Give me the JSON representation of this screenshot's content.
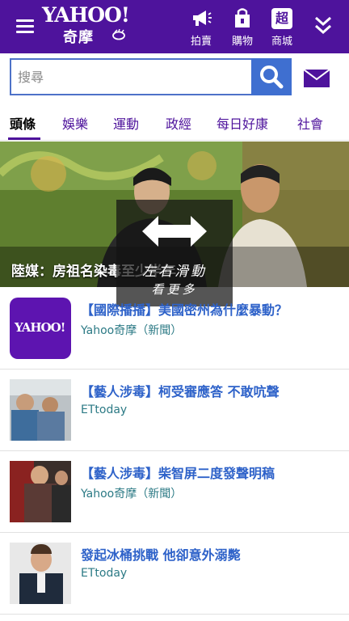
{
  "header": {
    "logo_en": "YAHOO!",
    "logo_zh": "奇摩",
    "items": [
      {
        "label": "拍賣",
        "icon": "megaphone-icon"
      },
      {
        "label": "購物",
        "icon": "shopping-bag-icon"
      },
      {
        "label": "商城",
        "icon": "mall-chao-icon",
        "glyph": "超"
      }
    ],
    "more_icon": "double-chevron-down-icon",
    "brand_color": "#4e139c"
  },
  "search": {
    "placeholder": "搜尋",
    "button_icon": "search-icon",
    "mail_icon": "mail-icon"
  },
  "tabs": [
    {
      "label": "頭條",
      "active": true
    },
    {
      "label": "娛樂",
      "active": false
    },
    {
      "label": "運動",
      "active": false
    },
    {
      "label": "政經",
      "active": false
    },
    {
      "label": "每日好康",
      "active": false
    },
    {
      "label": "社會",
      "active": false
    }
  ],
  "hero": {
    "caption": "陸媒：房祖名染毒至少半年",
    "swipe_hint": {
      "line1": "左右滑動",
      "line2": "看更多",
      "icon": "swipe-arrows-icon"
    }
  },
  "news": [
    {
      "title": "【國際播播】美國密州為什麼暴動？",
      "source": "Yahoo奇摩（新聞）",
      "thumb": "yahoo-logo-thumb"
    },
    {
      "title": "【藝人涉毒】柯受審應答 不敢吭聲",
      "source": "ETtoday",
      "thumb": "news-photo-thumb"
    },
    {
      "title": "【藝人涉毒】柴智屏二度發聲明稿",
      "source": "Yahoo奇摩（新聞）",
      "thumb": "news-photo-thumb"
    },
    {
      "title": "發起冰桶挑戰 他卻意外溺斃",
      "source": "ETtoday",
      "thumb": "news-photo-thumb"
    }
  ],
  "thumb_logo_text": "YAHOO!"
}
